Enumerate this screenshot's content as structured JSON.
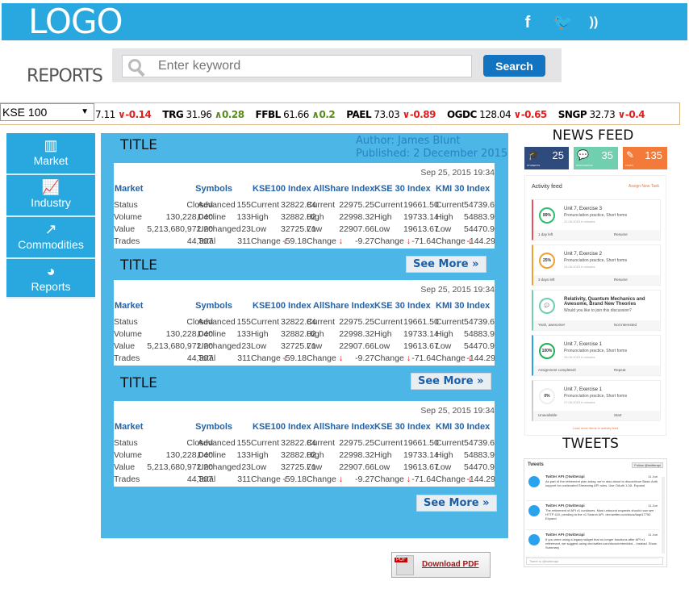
{
  "header": {
    "logo": "LOGO",
    "social": [
      {
        "icon": "facebook-icon",
        "glyph": "f"
      },
      {
        "icon": "twitter-icon",
        "glyph": "t"
      },
      {
        "icon": "rss-icon",
        "glyph": ")"
      }
    ],
    "color": "#29a8e0"
  },
  "page_title": "REPORTS",
  "search": {
    "placeholder": "Enter keyword",
    "button": "Search"
  },
  "ticker": {
    "selected": "KSE 100",
    "items": [
      {
        "sym": "",
        "price": "7.11",
        "dir": "down",
        "chg": "-0.14"
      },
      {
        "sym": "TRG",
        "price": "31.96",
        "dir": "up",
        "chg": "0.28"
      },
      {
        "sym": "FFBL",
        "price": "61.66",
        "dir": "up",
        "chg": "0.2"
      },
      {
        "sym": "PAEL",
        "price": "73.03",
        "dir": "down",
        "chg": "-0.89"
      },
      {
        "sym": "OGDC",
        "price": "128.04",
        "dir": "down",
        "chg": "-0.65"
      },
      {
        "sym": "SNGP",
        "price": "32.73",
        "dir": "down",
        "chg": "-0.4"
      }
    ]
  },
  "sidebar": [
    {
      "label": "Market",
      "icon": "bar-chart-icon",
      "glyph": "▥"
    },
    {
      "label": "Industry",
      "icon": "line-chart-icon",
      "glyph": "📈"
    },
    {
      "label": "Commodities",
      "icon": "external-link-icon",
      "glyph": "↗"
    },
    {
      "label": "Reports",
      "icon": "pie-chart-icon",
      "glyph": "◕"
    }
  ],
  "meta": {
    "author": "Author: James Blunt",
    "published": "Published: 2 December 2015"
  },
  "reports": [
    {
      "title": "TITLE",
      "see_more": "See More »"
    },
    {
      "title": "TITLE",
      "see_more": "See More »"
    },
    {
      "title": "TITLE",
      "see_more": "See More »"
    }
  ],
  "market_table": {
    "timestamp": "Sep 25, 2015 19:34",
    "headers": [
      "Market",
      "Symbols",
      "KSE100 Index",
      "AllShare Index",
      "KSE 30 Index",
      "KMI 30 Index"
    ],
    "rows": [
      [
        "Status",
        "Closed",
        "Advanced",
        "155",
        "Current",
        "32822.84",
        "Current",
        "22975.25",
        "Current",
        "19661.50",
        "Current",
        "54739.69"
      ],
      [
        "Volume",
        "130,228,040",
        "Decline",
        "133",
        "High",
        "32882.02",
        "High",
        "22998.32",
        "High",
        "19733.14",
        "High",
        "54883.98"
      ],
      [
        "Value",
        "5,213,680,972.20",
        "Unchanged",
        "23",
        "Low",
        "32725.71",
        "Low",
        "22907.66",
        "Low",
        "19613.67",
        "Low",
        "54470.94"
      ],
      [
        "Trades",
        "44,307",
        "Total",
        "311",
        "Change",
        "-59.18",
        "Change",
        "-9.27",
        "Change",
        "-71.64",
        "Change",
        "-144.29"
      ]
    ]
  },
  "download": "Download PDF",
  "news": {
    "title": "NEWS FEED",
    "stats": [
      {
        "n": "25",
        "label": "STUDENTS",
        "icon": "graduation-cap-icon",
        "glyph": "🎓",
        "color": "#2f4a7c"
      },
      {
        "n": "35",
        "label": "DISCUSSIONS",
        "icon": "chat-icon",
        "glyph": "💬",
        "color": "#6fcfae"
      },
      {
        "n": "135",
        "label": "TASKS",
        "icon": "pencil-icon",
        "glyph": "✎",
        "color": "#f47a3a"
      }
    ],
    "feed_title": "Activity feed",
    "assign": "Assign New Task",
    "cards": [
      {
        "ring": "89%",
        "unit": "Unit 7, Exercise 3",
        "desc": "Pronunciation practice, Short forms",
        "meta": "22.08.2015   8 minutes",
        "left": "1 day left",
        "right": "Resume",
        "color": "#e8505b"
      },
      {
        "ring": "25%",
        "unit": "Unit 7, Exercise 2",
        "desc": "Pronunciation practice, Short forms",
        "meta": "24.08.2015   8 minutes",
        "left": "3 days left",
        "right": "Resume",
        "color": "#f0a030"
      },
      {
        "ring": "",
        "unit": "Relativity, Quantum Mechanics and Awesome, Brand New Theories",
        "desc": "Would you like to join this discussion?",
        "meta": "",
        "left": "Yeah, awesome!",
        "right": "Not interested",
        "color": "#6fcfae"
      },
      {
        "ring": "100%",
        "unit": "Unit 7, Exercise 1",
        "desc": "Pronunciation practice, Short forms",
        "meta": "28.08.2015   8 minutes",
        "left": "Assignment completed!",
        "right": "Repeat",
        "color": "#2aa3e0"
      },
      {
        "ring": "0%",
        "unit": "Unit 7, Exercise 1",
        "desc": "Pronunciation practice, Short forms",
        "meta": "27.08.2015   8 minutes",
        "left": "Unavailable",
        "right": "Start",
        "color": "#ccc"
      }
    ],
    "load_more": "Load more items in activity feed"
  },
  "tweets": {
    "title": "TWEETS",
    "widget_title": "Tweets",
    "follow": "Follow @twitterapi",
    "input_placeholder": "Tweet to @twitterapi",
    "items": [
      {
        "name": "Twitter API @twitterapi",
        "date": "11 Jun",
        "text": "As part of the retirement plan today, we're also about to discontinue Basic Auth support for unelevated Streaming API roles. Use OAuth 1.0A. Expand"
      },
      {
        "name": "Twitter API @twitterapi",
        "date": "11 Jun",
        "text": "The retirement of API v1 continues. Most unbound requests should now see HTTP 410, pending to the v1 Search API. dev.twitter.com/docs/faq#17750 Expand"
      },
      {
        "name": "Twitter API @twitterapi",
        "date": "11 Jun",
        "text": "If you were using a legacy widget that no longer functions after API v1 retirement, we suggest using dev.twitter.com/docs/embedded... instead. Show Summary"
      }
    ]
  }
}
